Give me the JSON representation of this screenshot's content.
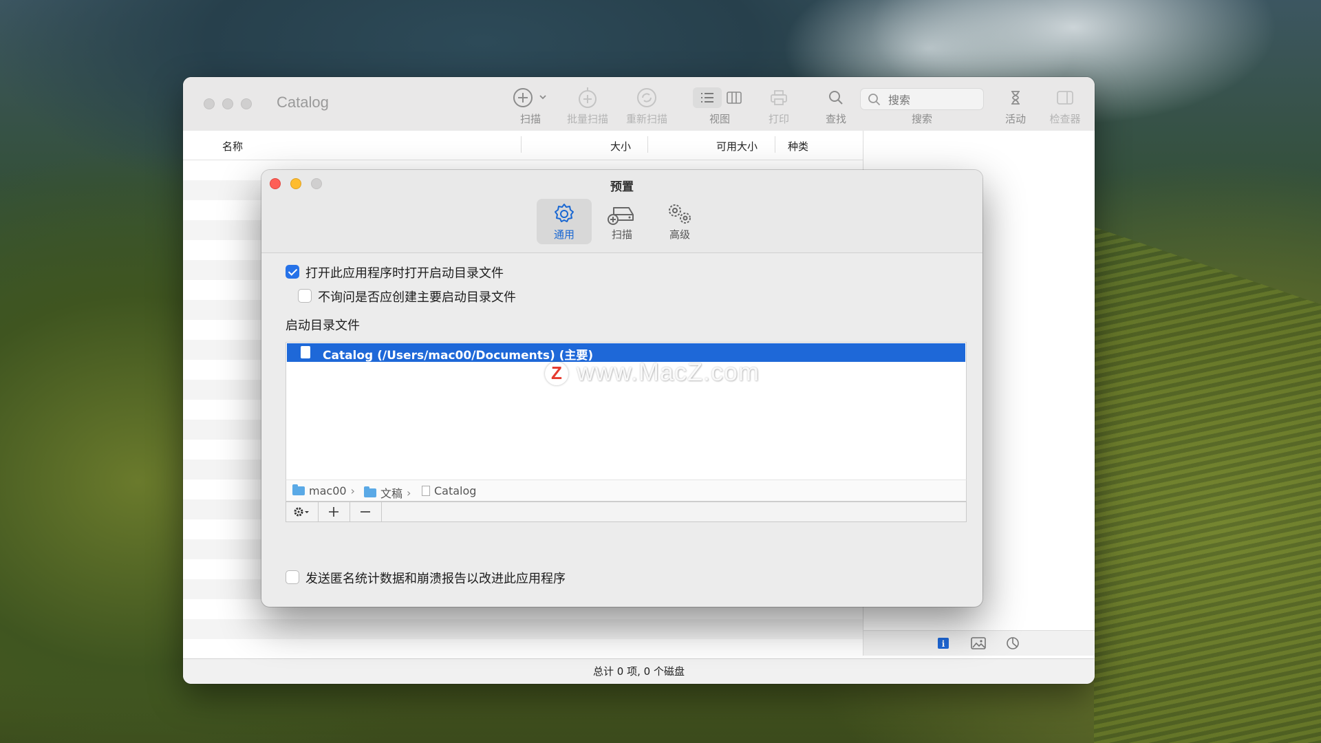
{
  "app": {
    "title": "Catalog",
    "accent_color": "#2672e8"
  },
  "toolbar": {
    "scan": "扫描",
    "batch_scan": "批量扫描",
    "rescan": "重新扫描",
    "view": "视图",
    "print": "打印",
    "find": "查找",
    "search_label": "搜索",
    "search_placeholder": "搜索",
    "activity": "活动",
    "inspector": "检查器"
  },
  "columns": {
    "name": "名称",
    "size": "大小",
    "available_size": "可用大小",
    "kind": "种类"
  },
  "status": {
    "text": "总计 0 项, 0 个磁盘"
  },
  "inspector_tabs": [
    "info-icon",
    "image-icon",
    "chart-icon"
  ],
  "preferences": {
    "title": "预置",
    "tabs": [
      {
        "label": "通用",
        "icon": "gear-icon",
        "active": true
      },
      {
        "label": "扫描",
        "icon": "disk-add-icon",
        "active": false
      },
      {
        "label": "高级",
        "icon": "gears-icon",
        "active": false
      }
    ],
    "open_on_launch": {
      "label": "打开此应用程序时打开启动目录文件",
      "checked": true
    },
    "dont_ask": {
      "label": "不询问是否应创建主要启动目录文件",
      "checked": false
    },
    "startup_section_label": "启动目录文件",
    "startup_items": [
      "Catalog (/Users/mac00/Documents) (主要)"
    ],
    "path": [
      "mac00",
      "文稿",
      "Catalog"
    ],
    "send_stats": {
      "label": "发送匿名统计数据和崩溃报告以改进此应用程序",
      "checked": false
    }
  },
  "watermark": {
    "logo": "Z",
    "text": "www.MacZ.com"
  }
}
